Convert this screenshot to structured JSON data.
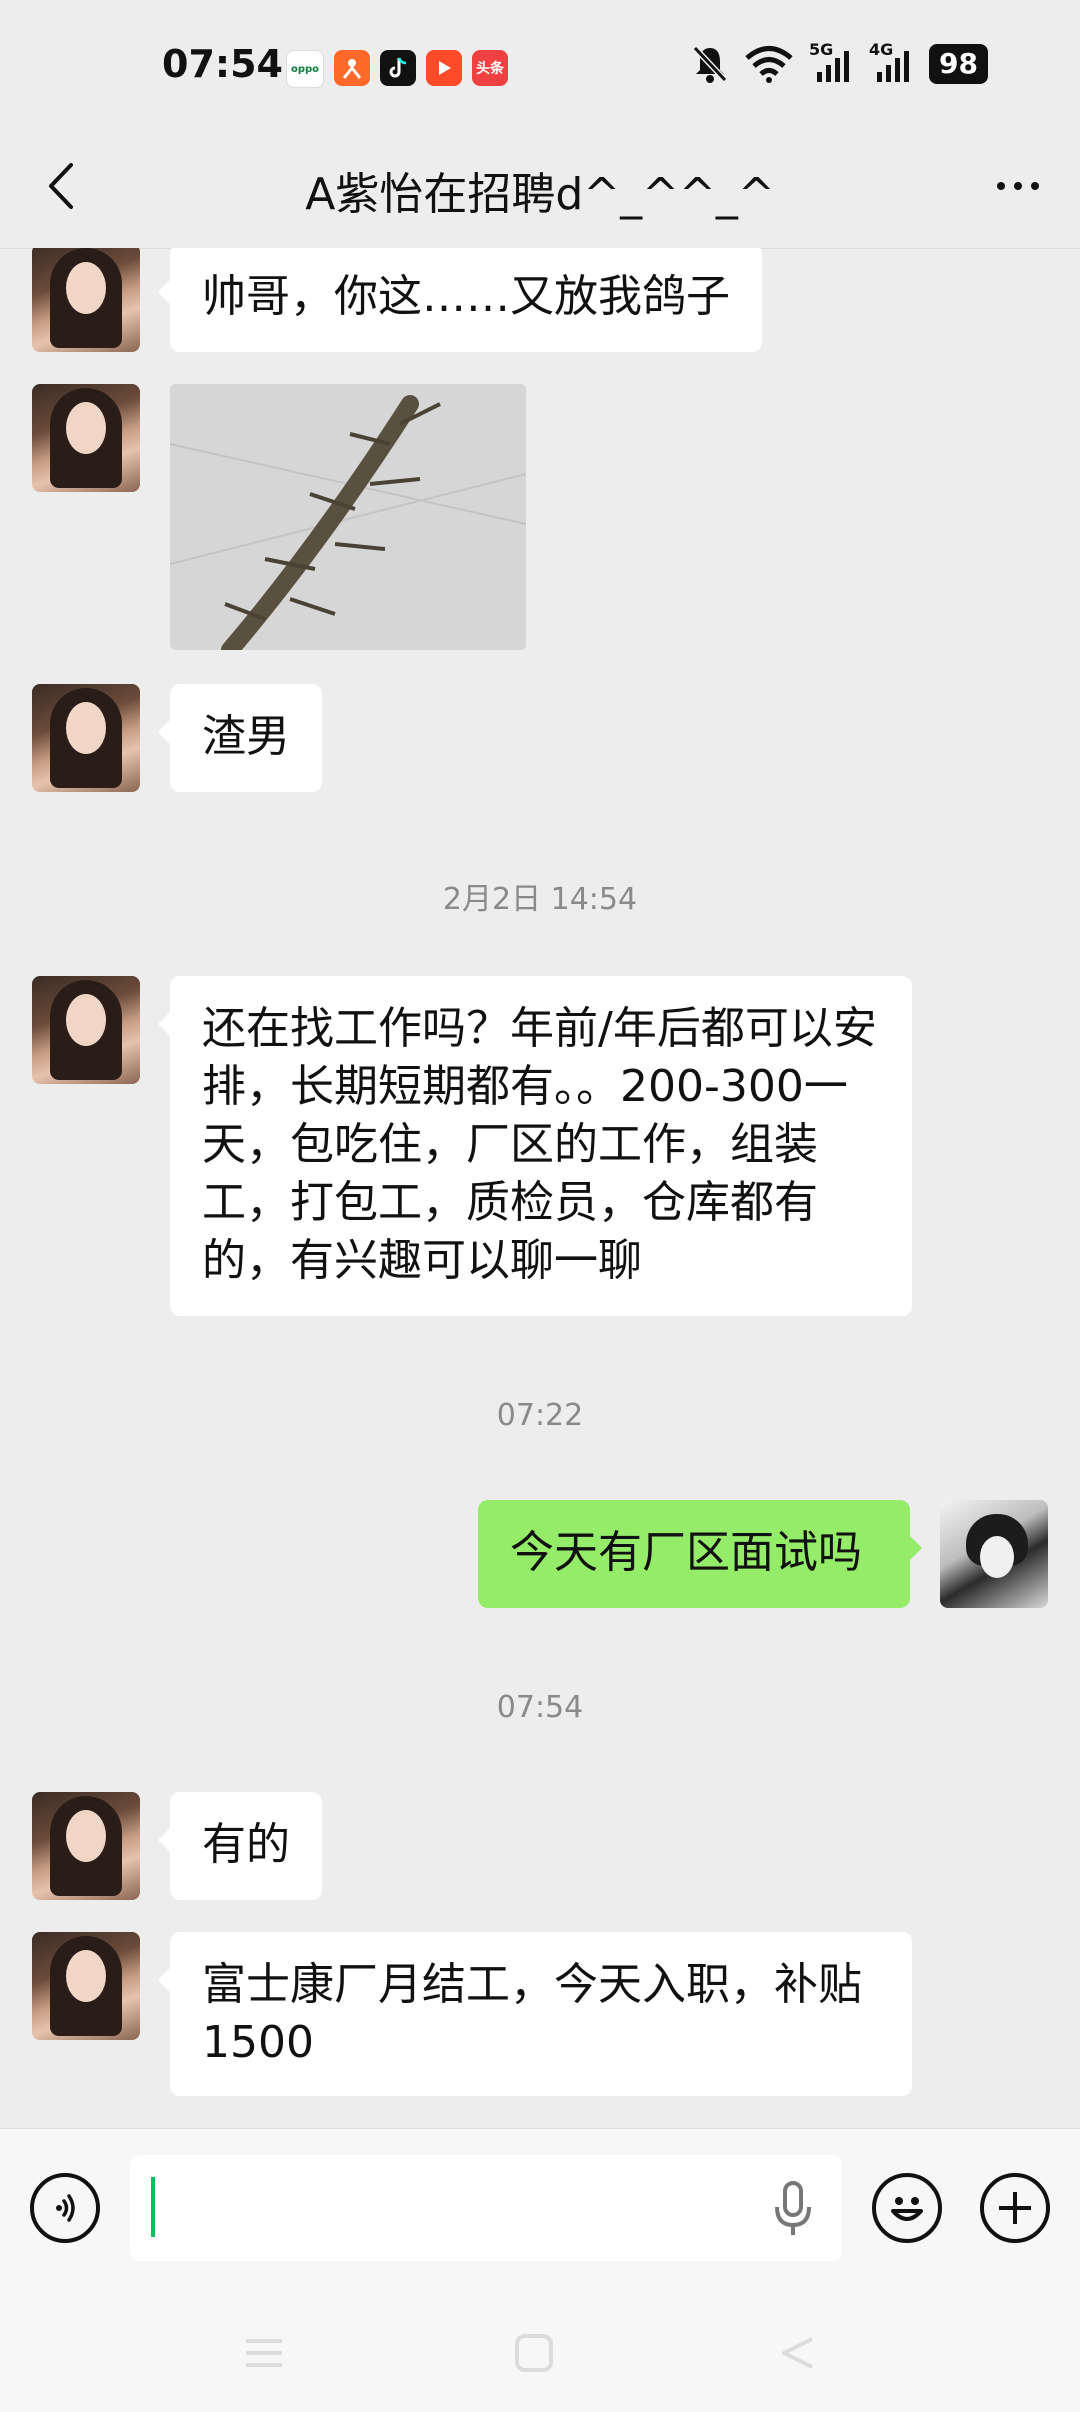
{
  "status_bar": {
    "time": "07:54",
    "app_icons": [
      "oppo-icon",
      "pinduoduo-icon",
      "tiktok-icon",
      "video-icon",
      "toutiao-icon"
    ],
    "app_icon_labels": [
      "oppo",
      "",
      "",
      "",
      "头条"
    ],
    "network_5g": "5G",
    "network_4g": "4G",
    "battery": "98"
  },
  "header": {
    "title": "A紫怡在招聘d^_^^_^",
    "back_icon": "chevron-left-icon",
    "more_icon": "more-dots-icon"
  },
  "messages": [
    {
      "sender": "contact",
      "type": "text",
      "text": "帅哥，你这……又放我鸽子"
    },
    {
      "sender": "contact",
      "type": "image",
      "description_icon": "image-thumbnail"
    },
    {
      "sender": "contact",
      "type": "text",
      "text": "渣男"
    },
    {
      "type": "timestamp",
      "text": "2月2日 14:54"
    },
    {
      "sender": "contact",
      "type": "text",
      "text": "还在找工作吗？年前/年后都可以安排，长期短期都有。。200-300一天，包吃住，厂区的工作，组装工，打包工，质检员，仓库都有的，有兴趣可以聊一聊"
    },
    {
      "type": "timestamp",
      "text": "07:22"
    },
    {
      "sender": "me",
      "type": "text",
      "text": "今天有厂区面试吗"
    },
    {
      "type": "timestamp",
      "text": "07:54"
    },
    {
      "sender": "contact",
      "type": "text",
      "text": "有的"
    },
    {
      "sender": "contact",
      "type": "text",
      "text": "富士康厂月结工，今天入职，补贴1500"
    }
  ],
  "input_bar": {
    "input_value": "",
    "voice_icon": "voice-mode-icon",
    "mic_icon": "microphone-icon",
    "emoji_icon": "emoji-icon",
    "plus_icon": "plus-icon"
  },
  "colors": {
    "background": "#ededed",
    "my_bubble": "#95ec69",
    "their_bubble": "#ffffff",
    "caret": "#07c160"
  }
}
